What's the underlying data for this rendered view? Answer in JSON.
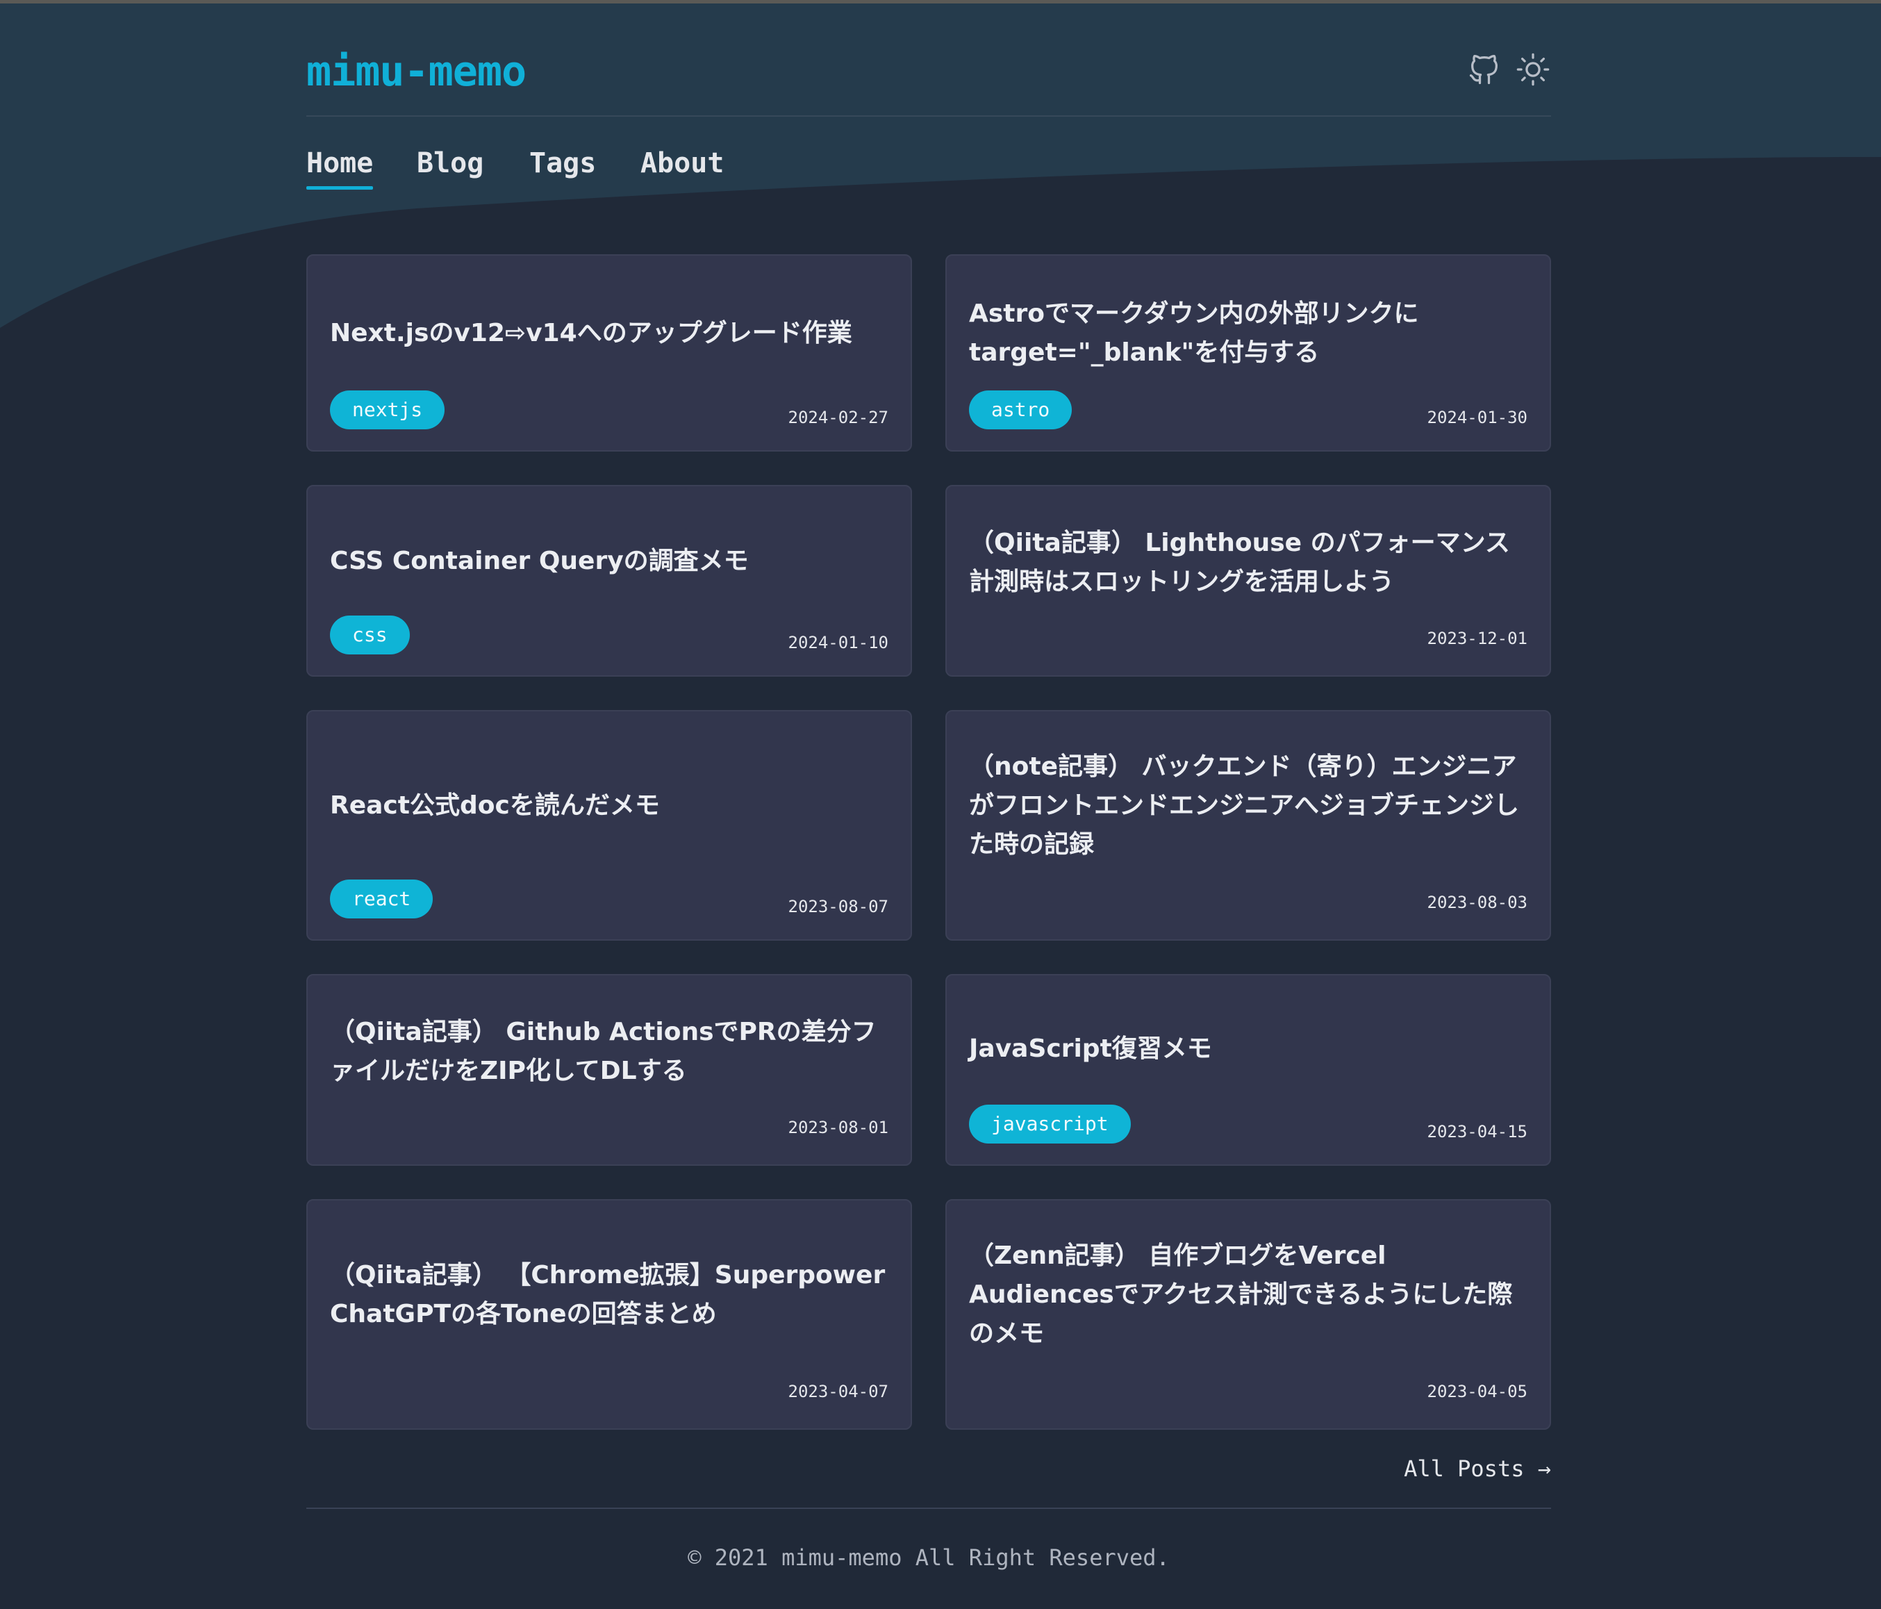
{
  "site": {
    "logo": "mimu-memo"
  },
  "header": {
    "github_icon": "github-icon",
    "theme_icon": "sun-icon"
  },
  "nav": {
    "items": [
      {
        "label": "Home",
        "active": true
      },
      {
        "label": "Blog",
        "active": false
      },
      {
        "label": "Tags",
        "active": false
      },
      {
        "label": "About",
        "active": false
      }
    ]
  },
  "posts": [
    {
      "title": "Next.jsのv12⇨v14へのアップグレード作業",
      "tag": "nextjs",
      "date": "2024-02-27"
    },
    {
      "title": "Astroでマークダウン内の外部リンクにtarget=\"_blank\"を付与する",
      "tag": "astro",
      "date": "2024-01-30"
    },
    {
      "title": "CSS Container Queryの調査メモ",
      "tag": "css",
      "date": "2024-01-10"
    },
    {
      "title": "（Qiita記事） Lighthouse のパフォーマンス計測時はスロットリングを活用しよう",
      "tag": "",
      "date": "2023-12-01"
    },
    {
      "title": "React公式docを読んだメモ",
      "tag": "react",
      "date": "2023-08-07"
    },
    {
      "title": "（note記事） バックエンド（寄り）エンジニアがフロントエンドエンジニアへジョブチェンジした時の記録",
      "tag": "",
      "date": "2023-08-03"
    },
    {
      "title": "（Qiita記事） Github ActionsでPRの差分ファイルだけをZIP化してDLする",
      "tag": "",
      "date": "2023-08-01"
    },
    {
      "title": "JavaScript復習メモ",
      "tag": "javascript",
      "date": "2023-04-15"
    },
    {
      "title": "（Qiita記事） 【Chrome拡張】Superpower ChatGPTの各Toneの回答まとめ",
      "tag": "",
      "date": "2023-04-07"
    },
    {
      "title": "（Zenn記事） 自作ブログをVercel Audiencesでアクセス計測できるようにした際のメモ",
      "tag": "",
      "date": "2023-04-05"
    }
  ],
  "all_posts_label": "All Posts →",
  "footer": {
    "text": "© 2021 mimu-memo All Right Reserved."
  },
  "colors": {
    "background": "#202938",
    "header_wave": "#253b4c",
    "card": "#32364d",
    "accent": "#10b0d8",
    "tag": "#0fb4d6"
  }
}
